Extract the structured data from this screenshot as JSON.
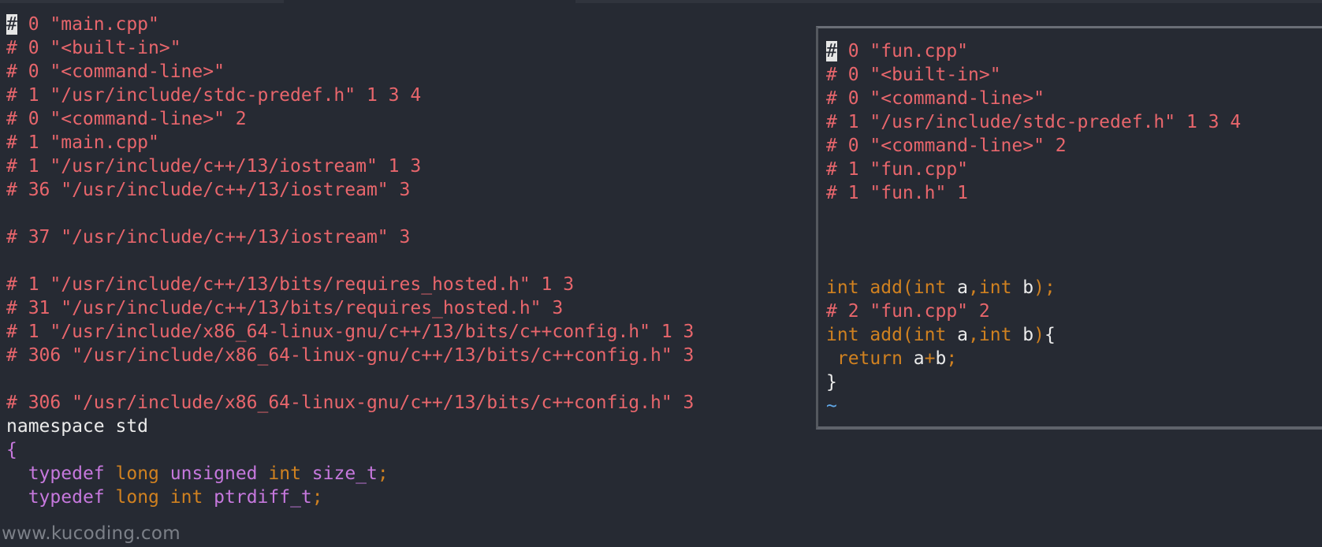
{
  "main_editor": {
    "line_1": {
      "cursor": "#",
      "text": " 0 \"main.cpp\""
    },
    "line_2": "# 0 \"<built-in>\"",
    "line_3": "# 0 \"<command-line>\"",
    "line_4": "# 1 \"/usr/include/stdc-predef.h\" 1 3 4",
    "line_5": "# 0 \"<command-line>\" 2",
    "line_6": "# 1 \"main.cpp\"",
    "line_7": "# 1 \"/usr/include/c++/13/iostream\" 1 3",
    "line_8": "# 36 \"/usr/include/c++/13/iostream\" 3",
    "line_10": "# 37 \"/usr/include/c++/13/iostream\" 3",
    "line_12": "# 1 \"/usr/include/c++/13/bits/requires_hosted.h\" 1 3",
    "line_13": "# 31 \"/usr/include/c++/13/bits/requires_hosted.h\" 3",
    "line_14": "# 1 \"/usr/include/x86_64-linux-gnu/c++/13/bits/c++config.h\" 1 3",
    "line_15": "# 306 \"/usr/include/x86_64-linux-gnu/c++/13/bits/c++config.h\" 3",
    "line_17": "# 306 \"/usr/include/x86_64-linux-gnu/c++/13/bits/c++config.h\" 3",
    "line_18": "namespace std",
    "line_19": "{",
    "line_20": {
      "indent": "  ",
      "k1": "typedef",
      "k2": "long",
      "k3": "unsigned",
      "k4": "int",
      "name": "size_t",
      "semi": ";"
    },
    "line_21": {
      "indent": "  ",
      "k1": "typedef",
      "k2": "long",
      "k3": "int",
      "name": "ptrdiff_t",
      "semi": ";"
    }
  },
  "float_editor": {
    "line_1": {
      "cursor": "#",
      "text": " 0 \"fun.cpp\""
    },
    "line_2": "# 0 \"<built-in>\"",
    "line_3": "# 0 \"<command-line>\"",
    "line_4": "# 1 \"/usr/include/stdc-predef.h\" 1 3 4",
    "line_5": "# 0 \"<command-line>\" 2",
    "line_6": "# 1 \"fun.cpp\"",
    "line_7": "# 1 \"fun.h\" 1",
    "line_11": {
      "t1": "int",
      "t2": " add(int ",
      "t3": "a",
      "t4": ",int ",
      "t5": "b",
      "t6": ");"
    },
    "line_12": "# 2 \"fun.cpp\" 2",
    "line_13": {
      "t1": "int",
      "t2": " add(int ",
      "t3": "a",
      "t4": ",int ",
      "t5": "b",
      "t6": ")",
      "t7": "{"
    },
    "line_14": {
      "t1": " return ",
      "t2": "a",
      "t3": "+",
      "t4": "b",
      "t5": ";"
    },
    "line_15": "}",
    "line_16": "~",
    "line_17": "~"
  },
  "watermark": "www.kucoding.com",
  "colors": {
    "background": "#262a33",
    "directive": "#e8666c",
    "keyword_purple": "#c678dd",
    "keyword_orange": "#d08120",
    "plain_text": "#ebebeb",
    "tilde": "#61a8e8"
  }
}
